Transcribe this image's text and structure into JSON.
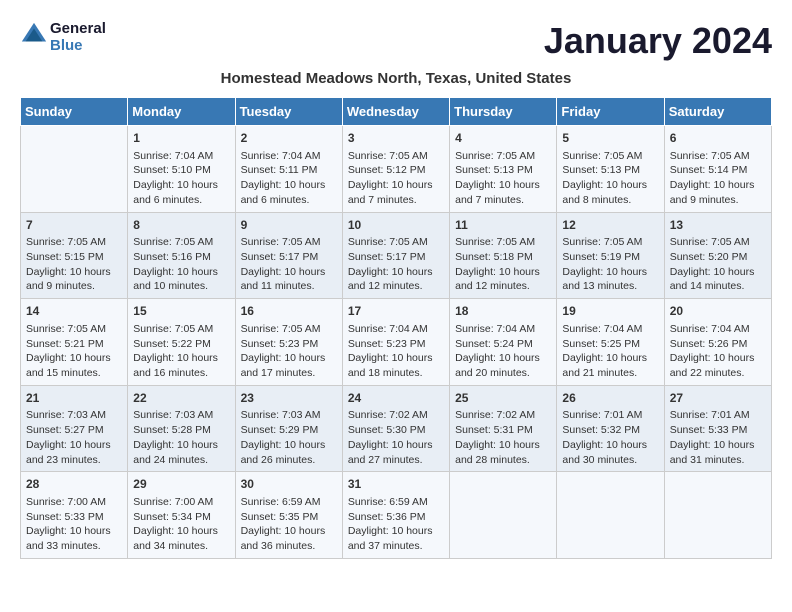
{
  "header": {
    "logo_line1": "General",
    "logo_line2": "Blue",
    "title": "January 2024",
    "subtitle": "Homestead Meadows North, Texas, United States"
  },
  "days_of_week": [
    "Sunday",
    "Monday",
    "Tuesday",
    "Wednesday",
    "Thursday",
    "Friday",
    "Saturday"
  ],
  "weeks": [
    [
      {
        "day": "",
        "content": ""
      },
      {
        "day": "1",
        "content": "Sunrise: 7:04 AM\nSunset: 5:10 PM\nDaylight: 10 hours\nand 6 minutes."
      },
      {
        "day": "2",
        "content": "Sunrise: 7:04 AM\nSunset: 5:11 PM\nDaylight: 10 hours\nand 6 minutes."
      },
      {
        "day": "3",
        "content": "Sunrise: 7:05 AM\nSunset: 5:12 PM\nDaylight: 10 hours\nand 7 minutes."
      },
      {
        "day": "4",
        "content": "Sunrise: 7:05 AM\nSunset: 5:13 PM\nDaylight: 10 hours\nand 7 minutes."
      },
      {
        "day": "5",
        "content": "Sunrise: 7:05 AM\nSunset: 5:13 PM\nDaylight: 10 hours\nand 8 minutes."
      },
      {
        "day": "6",
        "content": "Sunrise: 7:05 AM\nSunset: 5:14 PM\nDaylight: 10 hours\nand 9 minutes."
      }
    ],
    [
      {
        "day": "7",
        "content": "Sunrise: 7:05 AM\nSunset: 5:15 PM\nDaylight: 10 hours\nand 9 minutes."
      },
      {
        "day": "8",
        "content": "Sunrise: 7:05 AM\nSunset: 5:16 PM\nDaylight: 10 hours\nand 10 minutes."
      },
      {
        "day": "9",
        "content": "Sunrise: 7:05 AM\nSunset: 5:17 PM\nDaylight: 10 hours\nand 11 minutes."
      },
      {
        "day": "10",
        "content": "Sunrise: 7:05 AM\nSunset: 5:17 PM\nDaylight: 10 hours\nand 12 minutes."
      },
      {
        "day": "11",
        "content": "Sunrise: 7:05 AM\nSunset: 5:18 PM\nDaylight: 10 hours\nand 12 minutes."
      },
      {
        "day": "12",
        "content": "Sunrise: 7:05 AM\nSunset: 5:19 PM\nDaylight: 10 hours\nand 13 minutes."
      },
      {
        "day": "13",
        "content": "Sunrise: 7:05 AM\nSunset: 5:20 PM\nDaylight: 10 hours\nand 14 minutes."
      }
    ],
    [
      {
        "day": "14",
        "content": "Sunrise: 7:05 AM\nSunset: 5:21 PM\nDaylight: 10 hours\nand 15 minutes."
      },
      {
        "day": "15",
        "content": "Sunrise: 7:05 AM\nSunset: 5:22 PM\nDaylight: 10 hours\nand 16 minutes."
      },
      {
        "day": "16",
        "content": "Sunrise: 7:05 AM\nSunset: 5:23 PM\nDaylight: 10 hours\nand 17 minutes."
      },
      {
        "day": "17",
        "content": "Sunrise: 7:04 AM\nSunset: 5:23 PM\nDaylight: 10 hours\nand 18 minutes."
      },
      {
        "day": "18",
        "content": "Sunrise: 7:04 AM\nSunset: 5:24 PM\nDaylight: 10 hours\nand 20 minutes."
      },
      {
        "day": "19",
        "content": "Sunrise: 7:04 AM\nSunset: 5:25 PM\nDaylight: 10 hours\nand 21 minutes."
      },
      {
        "day": "20",
        "content": "Sunrise: 7:04 AM\nSunset: 5:26 PM\nDaylight: 10 hours\nand 22 minutes."
      }
    ],
    [
      {
        "day": "21",
        "content": "Sunrise: 7:03 AM\nSunset: 5:27 PM\nDaylight: 10 hours\nand 23 minutes."
      },
      {
        "day": "22",
        "content": "Sunrise: 7:03 AM\nSunset: 5:28 PM\nDaylight: 10 hours\nand 24 minutes."
      },
      {
        "day": "23",
        "content": "Sunrise: 7:03 AM\nSunset: 5:29 PM\nDaylight: 10 hours\nand 26 minutes."
      },
      {
        "day": "24",
        "content": "Sunrise: 7:02 AM\nSunset: 5:30 PM\nDaylight: 10 hours\nand 27 minutes."
      },
      {
        "day": "25",
        "content": "Sunrise: 7:02 AM\nSunset: 5:31 PM\nDaylight: 10 hours\nand 28 minutes."
      },
      {
        "day": "26",
        "content": "Sunrise: 7:01 AM\nSunset: 5:32 PM\nDaylight: 10 hours\nand 30 minutes."
      },
      {
        "day": "27",
        "content": "Sunrise: 7:01 AM\nSunset: 5:33 PM\nDaylight: 10 hours\nand 31 minutes."
      }
    ],
    [
      {
        "day": "28",
        "content": "Sunrise: 7:00 AM\nSunset: 5:33 PM\nDaylight: 10 hours\nand 33 minutes."
      },
      {
        "day": "29",
        "content": "Sunrise: 7:00 AM\nSunset: 5:34 PM\nDaylight: 10 hours\nand 34 minutes."
      },
      {
        "day": "30",
        "content": "Sunrise: 6:59 AM\nSunset: 5:35 PM\nDaylight: 10 hours\nand 36 minutes."
      },
      {
        "day": "31",
        "content": "Sunrise: 6:59 AM\nSunset: 5:36 PM\nDaylight: 10 hours\nand 37 minutes."
      },
      {
        "day": "",
        "content": ""
      },
      {
        "day": "",
        "content": ""
      },
      {
        "day": "",
        "content": ""
      }
    ]
  ]
}
